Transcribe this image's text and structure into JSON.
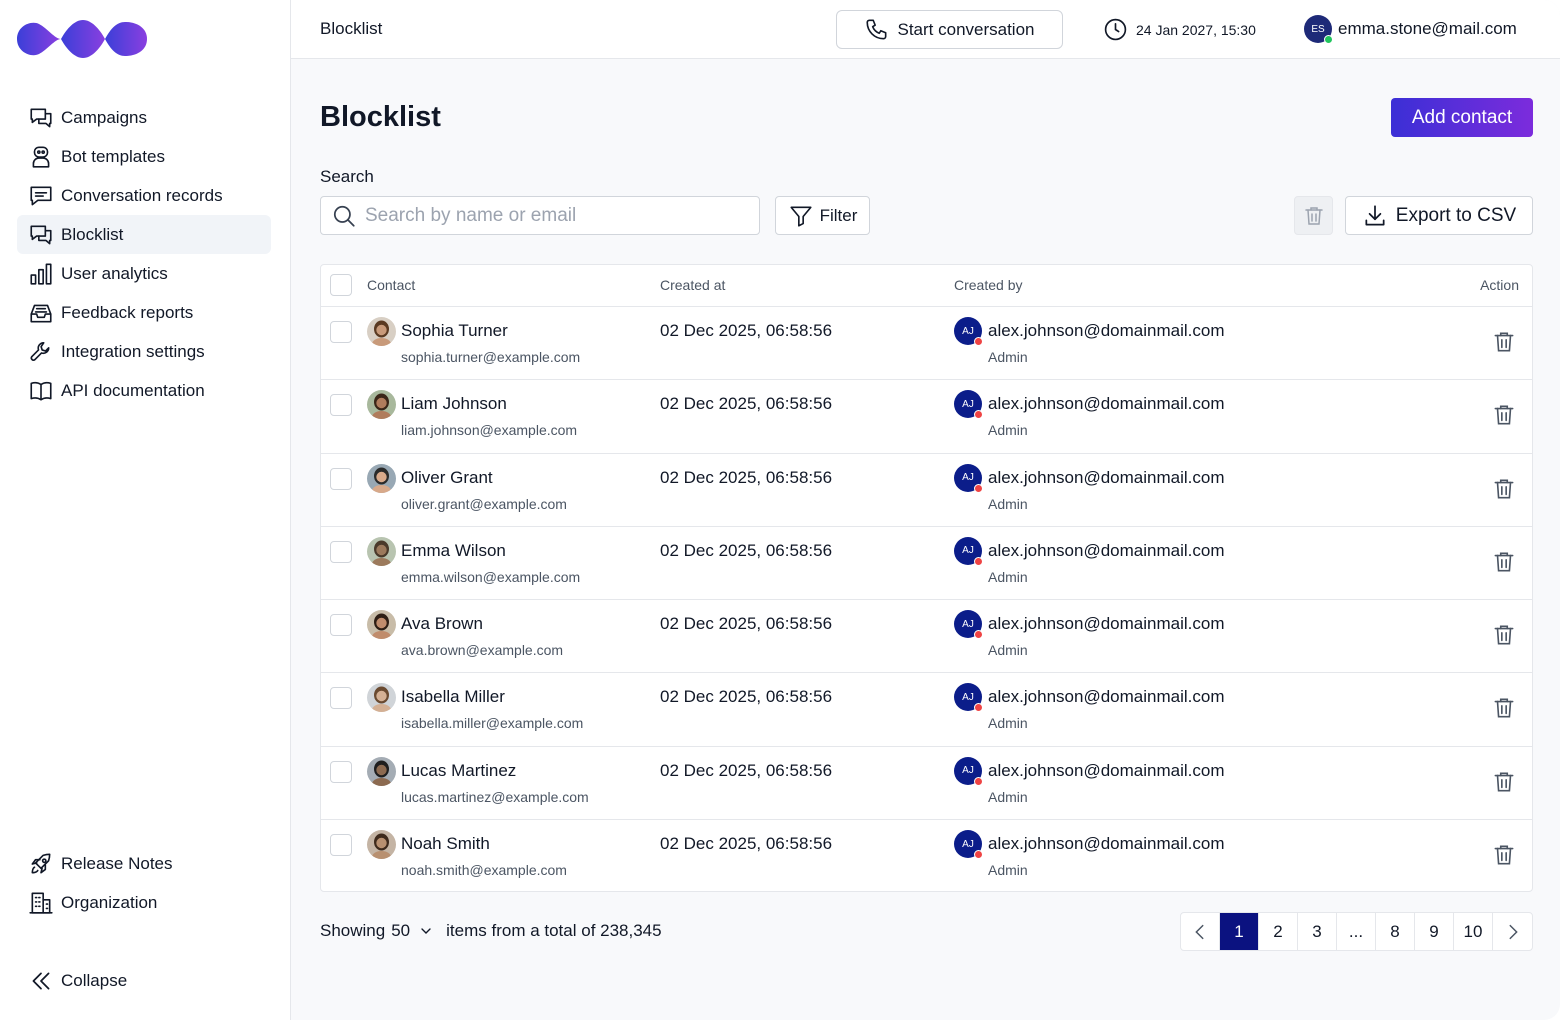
{
  "sidebar": {
    "items": [
      {
        "label": "Campaigns",
        "icon": "chat-bubbles-icon"
      },
      {
        "label": "Bot templates",
        "icon": "robot-icon"
      },
      {
        "label": "Conversation records",
        "icon": "message-square-icon"
      },
      {
        "label": "Blocklist",
        "icon": "chat-bubbles-icon",
        "active": true
      },
      {
        "label": "User analytics",
        "icon": "bar-chart-icon"
      },
      {
        "label": "Feedback reports",
        "icon": "inbox-icon"
      },
      {
        "label": "Integration settings",
        "icon": "wrench-icon"
      },
      {
        "label": "API documentation",
        "icon": "book-icon"
      }
    ],
    "bottom": [
      {
        "label": "Release Notes",
        "icon": "rocket-icon"
      },
      {
        "label": "Organization",
        "icon": "building-icon"
      }
    ],
    "collapse_label": "Collapse"
  },
  "header": {
    "title": "Blocklist",
    "start_conversation": "Start conversation",
    "datetime": "24 Jan 2027, 15:30",
    "user_initials": "ES",
    "user_email": "emma.stone@mail.com"
  },
  "page": {
    "title": "Blocklist",
    "add_contact": "Add contact",
    "search_label": "Search",
    "search_placeholder": "Search by name or email",
    "filter": "Filter",
    "export": "Export to CSV"
  },
  "table": {
    "columns": {
      "contact": "Contact",
      "created_at": "Created at",
      "created_by": "Created by",
      "action": "Action"
    },
    "rows": [
      {
        "name": "Sophia Turner",
        "email": "sophia.turner@example.com",
        "created": "02 Dec 2025, 06:58:56",
        "by_initials": "AJ",
        "by_email": "alex.johnson@domainmail.com",
        "by_role": "Admin"
      },
      {
        "name": "Liam Johnson",
        "email": "liam.johnson@example.com",
        "created": "02 Dec 2025, 06:58:56",
        "by_initials": "AJ",
        "by_email": "alex.johnson@domainmail.com",
        "by_role": "Admin"
      },
      {
        "name": "Oliver Grant",
        "email": "oliver.grant@example.com",
        "created": "02 Dec 2025, 06:58:56",
        "by_initials": "AJ",
        "by_email": "alex.johnson@domainmail.com",
        "by_role": "Admin"
      },
      {
        "name": "Emma Wilson",
        "email": "emma.wilson@example.com",
        "created": "02 Dec 2025, 06:58:56",
        "by_initials": "AJ",
        "by_email": "alex.johnson@domainmail.com",
        "by_role": "Admin"
      },
      {
        "name": "Ava Brown",
        "email": "ava.brown@example.com",
        "created": "02 Dec 2025, 06:58:56",
        "by_initials": "AJ",
        "by_email": "alex.johnson@domainmail.com",
        "by_role": "Admin"
      },
      {
        "name": "Isabella Miller",
        "email": "isabella.miller@example.com",
        "created": "02 Dec 2025, 06:58:56",
        "by_initials": "AJ",
        "by_email": "alex.johnson@domainmail.com",
        "by_role": "Admin"
      },
      {
        "name": "Lucas Martinez",
        "email": "lucas.martinez@example.com",
        "created": "02 Dec 2025, 06:58:56",
        "by_initials": "AJ",
        "by_email": "alex.johnson@domainmail.com",
        "by_role": "Admin"
      },
      {
        "name": "Noah Smith",
        "email": "noah.smith@example.com",
        "created": "02 Dec 2025, 06:58:56",
        "by_initials": "AJ",
        "by_email": "alex.johnson@domainmail.com",
        "by_role": "Admin"
      }
    ]
  },
  "footer": {
    "showing_prefix": "Showing",
    "page_size": "50",
    "showing_suffix": "items from a total of 238,345",
    "pages": [
      "1",
      "2",
      "3",
      "...",
      "8",
      "9",
      "10"
    ],
    "current_page": "1"
  },
  "colors": {
    "accent_start": "#3b2fd6",
    "accent_end": "#7c2cdc",
    "active_page": "#0b1280",
    "online": "#22c55e",
    "offline": "#ef4444"
  }
}
